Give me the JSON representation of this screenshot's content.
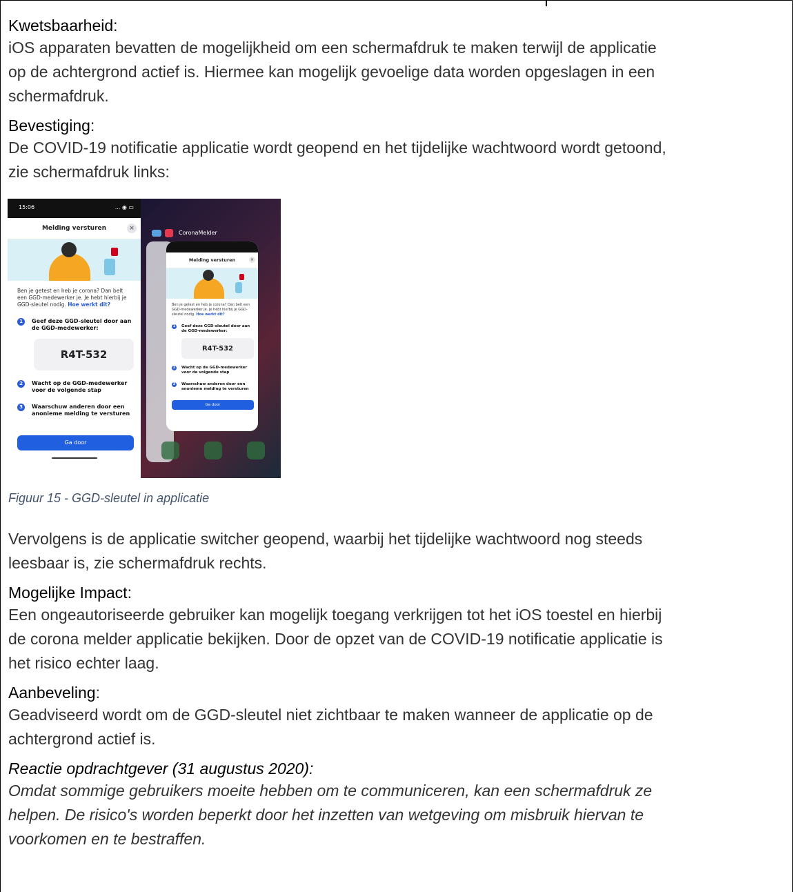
{
  "sections": {
    "vulnerability": {
      "heading": "Kwetsbaarheid:",
      "lines": [
        "iOS apparaten bevatten de mogelijkheid om een schermafdruk te maken terwijl de applicatie",
        "op de achtergrond actief is. Hiermee kan mogelijk gevoelige data worden opgeslagen in een",
        "schermafdruk."
      ]
    },
    "confirmation": {
      "heading": "Bevestiging:",
      "lines": [
        "De COVID-19 notificatie applicatie wordt geopend en het tijdelijke wachtwoord wordt getoond,",
        "zie schermafdruk links:"
      ]
    },
    "figure_caption": "Figuur 15 - GGD-sleutel in applicatie",
    "after_figure": {
      "lines": [
        "Vervolgens is de applicatie switcher geopend, waarbij het tijdelijke wachtwoord nog steeds",
        "leesbaar is, zie schermafdruk rechts."
      ]
    },
    "impact": {
      "heading": "Mogelijke Impact:",
      "lines": [
        "Een ongeautoriseerde gebruiker kan mogelijk toegang verkrijgen tot het iOS toestel en hierbij",
        "de corona melder applicatie bekijken. Door de opzet van de COVID-19 notificatie applicatie is",
        "het risico echter laag."
      ]
    },
    "recommendation": {
      "heading": "Aanbeveling",
      "colon": ":",
      "lines": [
        "Geadviseerd wordt om de GGD-sleutel niet zichtbaar te maken wanneer de applicatie op de",
        "achtergrond actief is."
      ]
    },
    "client_response": {
      "heading": "Reactie opdrachtgever (31 augustus 2020):",
      "lines": [
        "Omdat sommige gebruikers moeite hebben om te communiceren, kan een schermafdruk ze",
        "helpen. De risico's worden beperkt door het inzetten van wetgeving om misbruik hiervan te",
        "voorkomen en te bestraffen."
      ]
    }
  },
  "phone": {
    "time": "15:06",
    "signal": "... ◉ ▭",
    "sheet_title": "Melding versturen",
    "close": "×",
    "intro": "Ben je getest en heb je corona? Dan belt een GGD-medewerker je. Je hebt hierbij je GGD-sleutel nodig.",
    "intro_link": "Hoe werkt dit?",
    "steps": [
      {
        "num": "1",
        "text": "Geef deze GGD-sleutel door aan de GGD-medewerker:"
      },
      {
        "num": "2",
        "text": "Wacht op de GGD-medewerker voor de volgende stap"
      },
      {
        "num": "3",
        "text": "Waarschuw anderen door een anonieme melding te versturen"
      }
    ],
    "key": "R4T-532",
    "button": "Ga door",
    "switcher_app_label": "CoronaMelder"
  }
}
